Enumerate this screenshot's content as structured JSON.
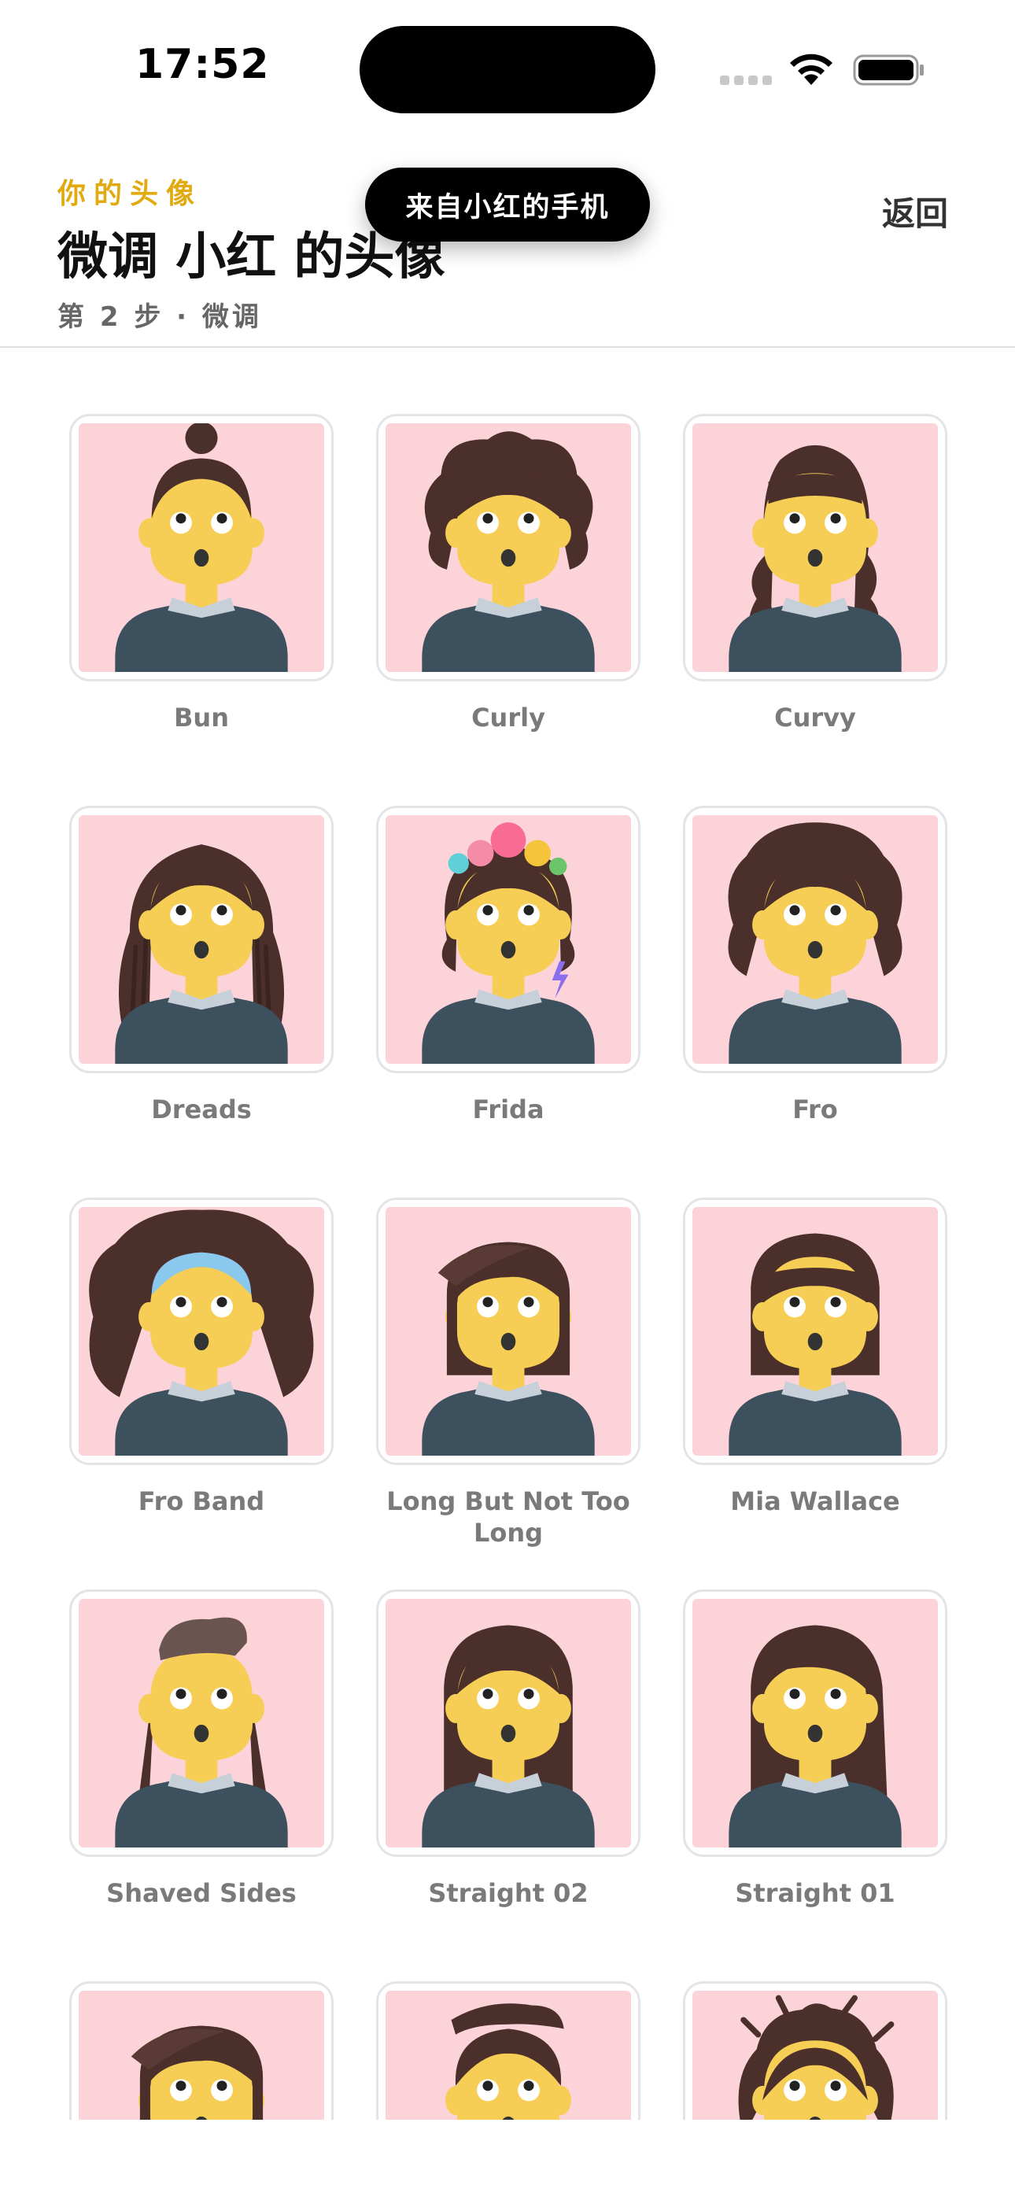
{
  "status_bar": {
    "time": "17:52"
  },
  "header": {
    "eyebrow": "你的头像",
    "title": "微调 小红 的头像",
    "step": "第 2 步 · 微调",
    "back_label": "返回",
    "toast": "来自小红的手机"
  },
  "colors": {
    "accent": "#e0aa10",
    "tile_background": "#fdd3da",
    "skin": "#f7ce55",
    "shirt": "#3d505d",
    "hair": "#4b2f2a"
  },
  "avatars": [
    {
      "label": "Bun",
      "hair": "bun-hair"
    },
    {
      "label": "Curly",
      "hair": "curly-hair"
    },
    {
      "label": "Curvy",
      "hair": "curvy-hair"
    },
    {
      "label": "Dreads",
      "hair": "dreads-hair"
    },
    {
      "label": "Frida",
      "hair": "frida-hair"
    },
    {
      "label": "Fro",
      "hair": "fro-hair"
    },
    {
      "label": "Fro Band",
      "hair": "fro-band-hair"
    },
    {
      "label": "Long But Not Too Long",
      "hair": "long-hair"
    },
    {
      "label": "Mia Wallace",
      "hair": "bob-bangs-hair"
    },
    {
      "label": "Shaved Sides",
      "hair": "shaved-sides-hair"
    },
    {
      "label": "Straight 02",
      "hair": "straight-hair"
    },
    {
      "label": "Straight 01",
      "hair": "straight-side-part-hair"
    },
    {
      "label": "",
      "hair": "long-hair"
    },
    {
      "label": "",
      "hair": "short-flat-hair"
    },
    {
      "label": "",
      "hair": "shaggy-hair"
    }
  ]
}
